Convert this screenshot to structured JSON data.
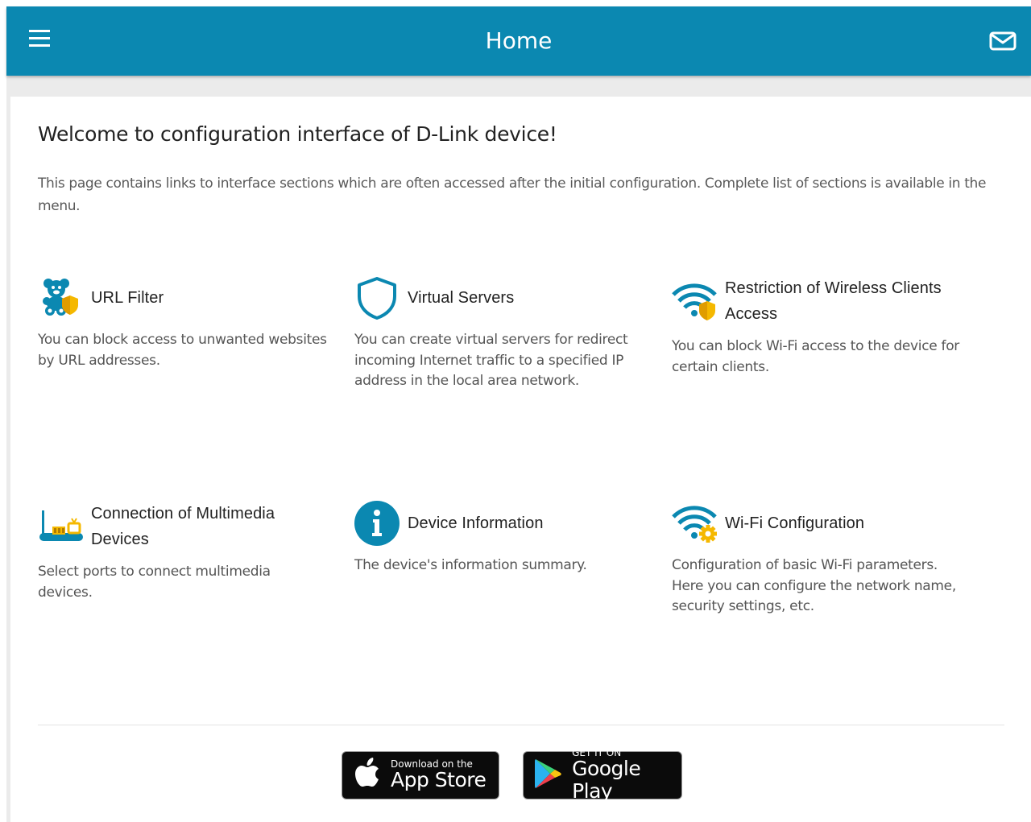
{
  "header": {
    "title": "Home",
    "menu_icon": "hamburger-menu-icon",
    "mail_icon": "mail-icon"
  },
  "welcome": "Welcome to configuration interface of D-Link device!",
  "intro": "This page contains links to interface sections which are often accessed after the initial configuration. Complete list of sections is available in the menu.",
  "cards": [
    {
      "icon": "teddy-bear-shield-icon",
      "title": "URL Filter",
      "description": "You can block access to unwanted websites by URL addresses."
    },
    {
      "icon": "shield-icon",
      "title": "Virtual Servers",
      "description": "You can create virtual servers for redirect incoming Internet traffic to a specified IP address in the local area network."
    },
    {
      "icon": "wifi-shield-icon",
      "title": "Restriction of Wireless Clients Access",
      "description": "You can block Wi-Fi access to the device for certain clients."
    },
    {
      "icon": "router-multimedia-icon",
      "title": "Connection of Multimedia Devices",
      "description": "Select ports to connect multimedia devices."
    },
    {
      "icon": "info-icon",
      "title": "Device Information",
      "description": "The device's information summary."
    },
    {
      "icon": "wifi-gear-icon",
      "title": "Wi-Fi Configuration",
      "description": "Configuration of basic Wi-Fi parameters. Here you can configure the network name, security settings, etc."
    }
  ],
  "stores": {
    "appstore": {
      "small": "Download on the",
      "big": "App Store"
    },
    "googleplay": {
      "small": "GET IT ON",
      "big": "Google Play"
    }
  },
  "colors": {
    "primary": "#0b88b1",
    "accent": "#f5b800",
    "text": "#222222"
  }
}
